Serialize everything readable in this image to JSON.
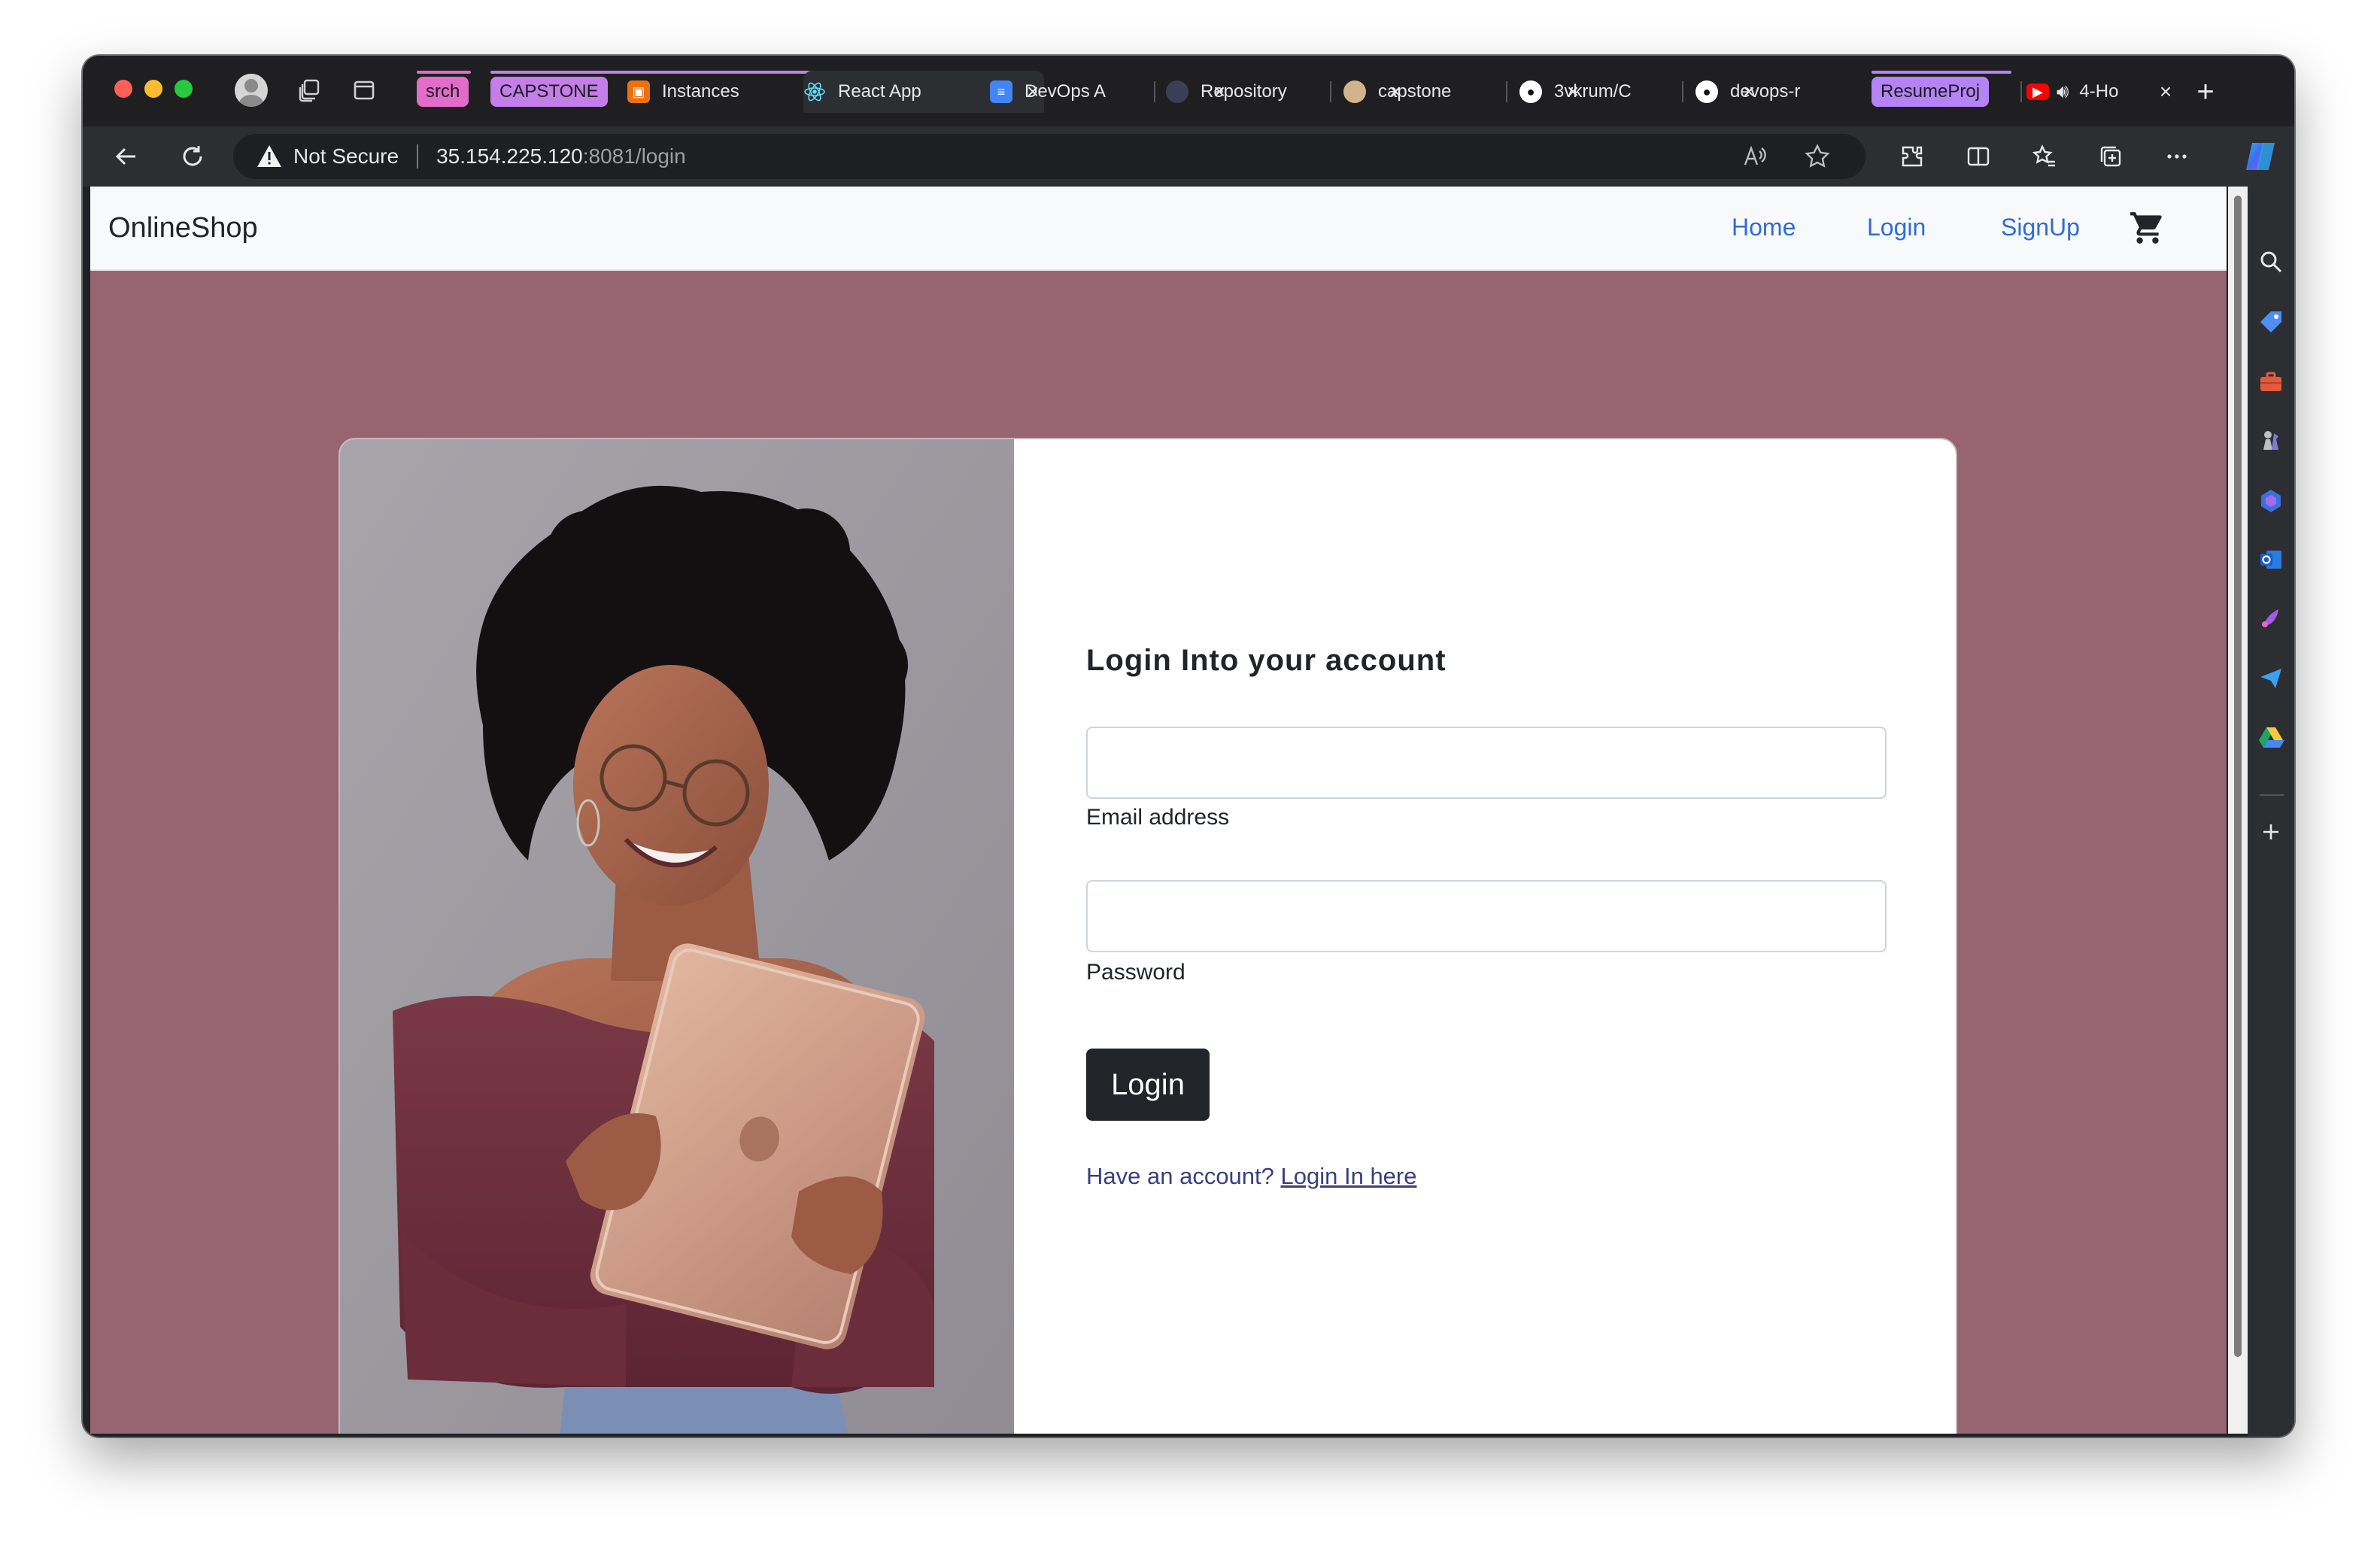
{
  "tabs": {
    "groups": [
      {
        "label": "srch",
        "color": "#e16cc9"
      },
      {
        "label": "CAPSTONE",
        "color": "#c37ee8"
      },
      {
        "label": "ResumeProj",
        "color": "#b483f5"
      }
    ],
    "items": [
      {
        "title": "Instances",
        "favicon": "aws-orange-icon",
        "accent": "#ec7211"
      },
      {
        "title": "React App",
        "favicon": "react-atom-icon",
        "accent": "#2d2e31"
      },
      {
        "title": "DevOps A",
        "favicon": "google-docs-icon",
        "accent": "#4285f4"
      },
      {
        "title": "Repository",
        "favicon": "circle-globe-icon",
        "accent": "#3a3f55"
      },
      {
        "title": "capstone",
        "favicon": "jenkins-icon",
        "accent": "#d2b48c"
      },
      {
        "title": "3vkrum/C",
        "favicon": "github-icon",
        "accent": "#ffffff"
      },
      {
        "title": "devops-r",
        "favicon": "github-icon",
        "accent": "#ffffff"
      },
      {
        "title": "4-Ho",
        "favicon": "youtube-icon",
        "accent": "#ff0000"
      }
    ]
  },
  "address_bar": {
    "security": "Not Secure",
    "host": "35.154.225.120",
    "path": ":8081/login"
  },
  "page": {
    "brand": "OnlineShop",
    "nav": {
      "home": "Home",
      "login": "Login",
      "signup": "SignUp"
    },
    "form": {
      "title": "Login Into your account",
      "email_label": "Email address",
      "email_value": "",
      "password_label": "Password",
      "password_value": "",
      "submit": "Login",
      "footer_text": "Have an account? ",
      "footer_link": "Login In here"
    },
    "colors": {
      "background": "#966571",
      "link": "#2f6bd8",
      "button": "#212529"
    }
  }
}
